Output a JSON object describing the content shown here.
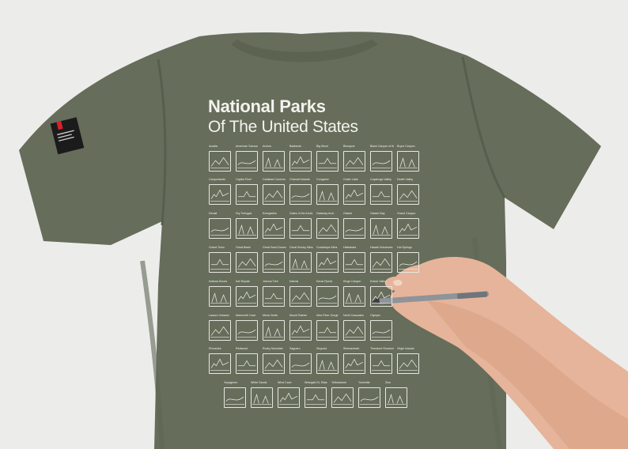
{
  "shirt": {
    "title": "National Parks",
    "subtitle": "Of The United States",
    "fabric_color": "#676e5b",
    "ink_color": "#f1f1ec"
  },
  "tag": {
    "color": "#1b1b1b",
    "accent": "#d8202a"
  },
  "parks": [
    [
      "Acadia",
      "American Samoa",
      "Arches",
      "Badlands",
      "Big Bend",
      "Biscayne",
      "Black Canyon of the Gunnison",
      "Bryce Canyon"
    ],
    [
      "Canyonlands",
      "Capitol Reef",
      "Carlsbad Caverns",
      "Channel Islands",
      "Congaree",
      "Crater Lake",
      "Cuyahoga Valley",
      "Death Valley"
    ],
    [
      "Denali",
      "Dry Tortugas",
      "Everglades",
      "Gates of the Arctic",
      "Gateway Arch",
      "Glacier",
      "Glacier Bay",
      "Grand Canyon"
    ],
    [
      "Grand Teton",
      "Great Basin",
      "Great Sand Dunes",
      "Great Smoky Mtns",
      "Guadalupe Mtns",
      "Haleakala",
      "Hawaii Volcanoes",
      "Hot Springs"
    ],
    [
      "Indiana Dunes",
      "Isle Royale",
      "Joshua Tree",
      "Katmai",
      "Kenai Fjords",
      "Kings Canyon",
      "Kobuk Valley",
      ""
    ],
    [
      "Lassen Volcanic",
      "Mammoth Cave",
      "Mesa Verde",
      "Mount Rainier",
      "New River Gorge",
      "North Cascades",
      "Olympic",
      ""
    ],
    [
      "Pinnacles",
      "Redwood",
      "Rocky Mountain",
      "Saguaro",
      "Sequoia",
      "Shenandoah",
      "Theodore Roosevelt",
      "Virgin Islands"
    ],
    [
      "Voyageurs",
      "White Sands",
      "Wind Cave",
      "Wrangell-St. Elias",
      "Yellowstone",
      "Yosemite",
      "Zion"
    ]
  ]
}
